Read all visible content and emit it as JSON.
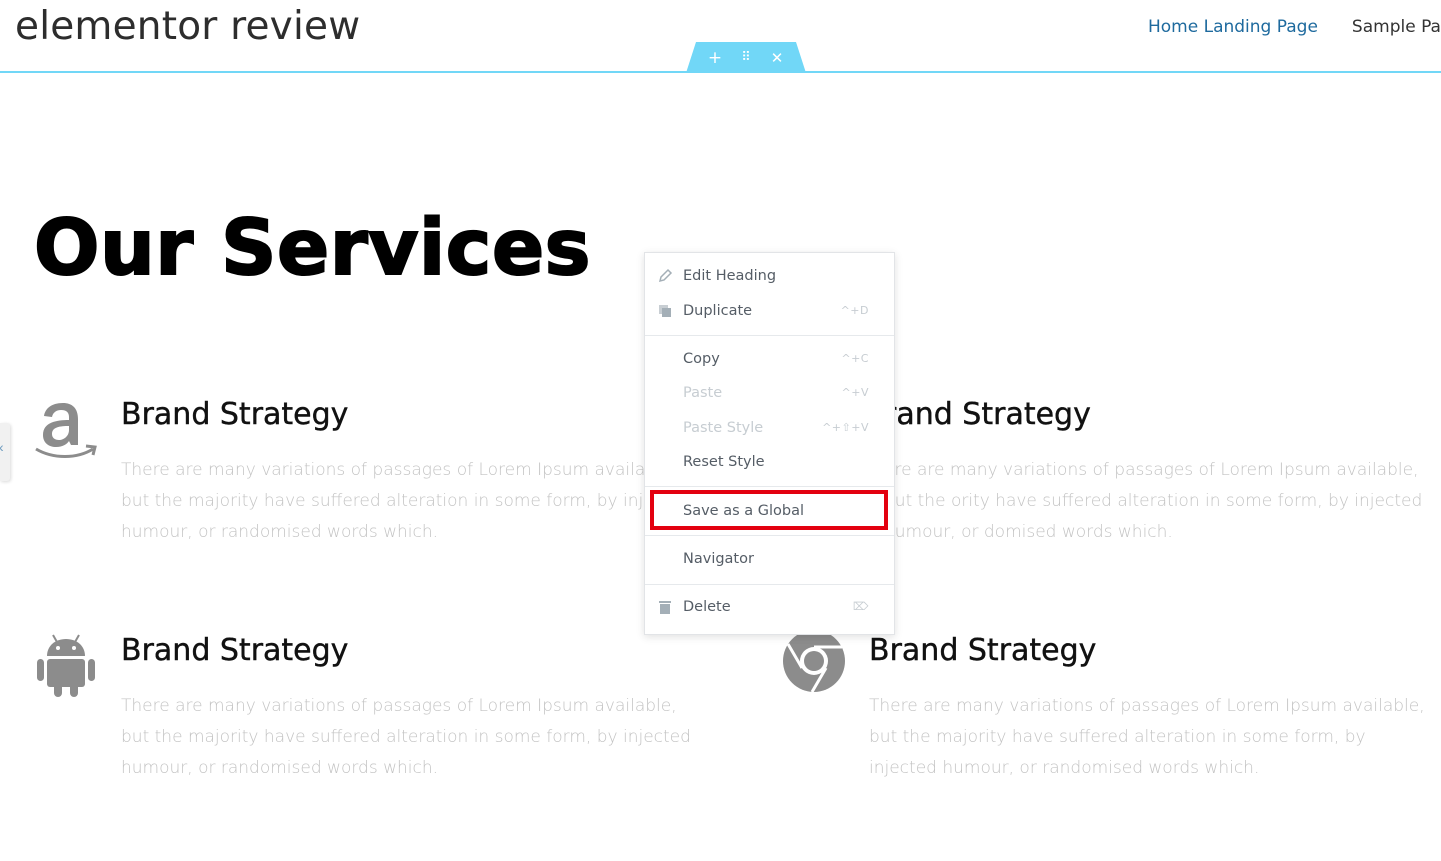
{
  "site": {
    "title": "elementor review"
  },
  "nav": {
    "items": [
      "Home Landing Page",
      "Sample Pag"
    ]
  },
  "section_handle": {
    "add": "+",
    "move": "⠿",
    "close": "✕"
  },
  "heading": "Our Services",
  "services": [
    {
      "icon": "amazon-icon",
      "title": "Brand Strategy",
      "desc": "There are many variations of passages of Lorem Ipsum available, but the majority have suffered alteration in some form, by injected humour, or randomised words which."
    },
    {
      "icon": "apple-icon",
      "title": "rand Strategy",
      "desc": "ere are many variations of passages of Lorem Ipsum available, but the ority have suffered alteration in some form, by injected humour, or domised words which."
    },
    {
      "icon": "android-icon",
      "title": "Brand Strategy",
      "desc": "There are many variations of passages of Lorem Ipsum available, but the majority have suffered alteration in some form, by injected humour, or randomised words which."
    },
    {
      "icon": "chrome-icon",
      "title": "Brand Strategy",
      "desc": "There are many variations of passages of Lorem Ipsum available, but the majority have suffered alteration in some form, by injected humour, or randomised words which."
    }
  ],
  "context_menu": {
    "edit": {
      "label": "Edit Heading",
      "icon": "pencil-icon"
    },
    "duplicate": {
      "label": "Duplicate",
      "shortcut": "^+D",
      "icon": "duplicate-icon"
    },
    "copy": {
      "label": "Copy",
      "shortcut": "^+C"
    },
    "paste": {
      "label": "Paste",
      "shortcut": "^+V",
      "disabled": true
    },
    "paste_style": {
      "label": "Paste Style",
      "shortcut": "^+⇧+V",
      "disabled": true
    },
    "reset_style": {
      "label": "Reset Style"
    },
    "save_global": {
      "label": "Save as a Global",
      "highlighted": true
    },
    "navigator": {
      "label": "Navigator"
    },
    "delete": {
      "label": "Delete",
      "shortcut": "⌦",
      "icon": "trash-icon"
    }
  },
  "colors": {
    "accent": "#71d7f7",
    "highlight": "#e3000f",
    "link": "#1e6a9e",
    "muted_text": "#c3c3c3"
  }
}
